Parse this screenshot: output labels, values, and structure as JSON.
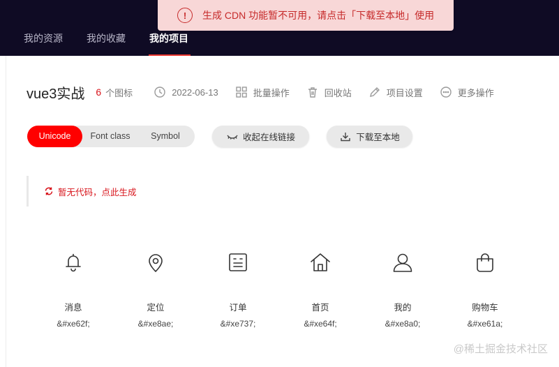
{
  "toast": {
    "icon": "!",
    "message": "生成 CDN 功能暂不可用，请点击「下载至本地」使用"
  },
  "nav": {
    "items": [
      {
        "label": "我的资源"
      },
      {
        "label": "我的收藏"
      },
      {
        "label": "我的项目"
      }
    ],
    "active": "我的项目"
  },
  "project": {
    "title": "vue3实战",
    "icon_count": "6",
    "icon_count_label": "个图标",
    "date": "2022-06-13",
    "batch": "批量操作",
    "recycle": "回收站",
    "settings": "项目设置",
    "more": "更多操作"
  },
  "tabs": {
    "unicode": "Unicode",
    "font_class": "Font class",
    "symbol": "Symbol",
    "active": "Unicode"
  },
  "actions": {
    "collapse": "收起在线链接",
    "download": "下载至本地"
  },
  "code_box": {
    "message": "暂无代码，点此生成"
  },
  "icons": [
    {
      "name": "消息",
      "code": "&#xe62f;",
      "icon": "bell-icon"
    },
    {
      "name": "定位",
      "code": "&#xe8ae;",
      "icon": "location-pin-icon"
    },
    {
      "name": "订单",
      "code": "&#xe737;",
      "icon": "order-list-icon"
    },
    {
      "name": "首页",
      "code": "&#xe64f;",
      "icon": "home-icon"
    },
    {
      "name": "我的",
      "code": "&#xe8a0;",
      "icon": "user-icon"
    },
    {
      "name": "购物车",
      "code": "&#xe61a;",
      "icon": "shopping-bag-icon"
    }
  ],
  "watermark": "@稀土掘金技术社区",
  "colors": {
    "accent": "#ff0000",
    "header_bg": "#0f0b24",
    "toast_bg": "#f8d7d7",
    "toast_text": "#c62a2a"
  }
}
